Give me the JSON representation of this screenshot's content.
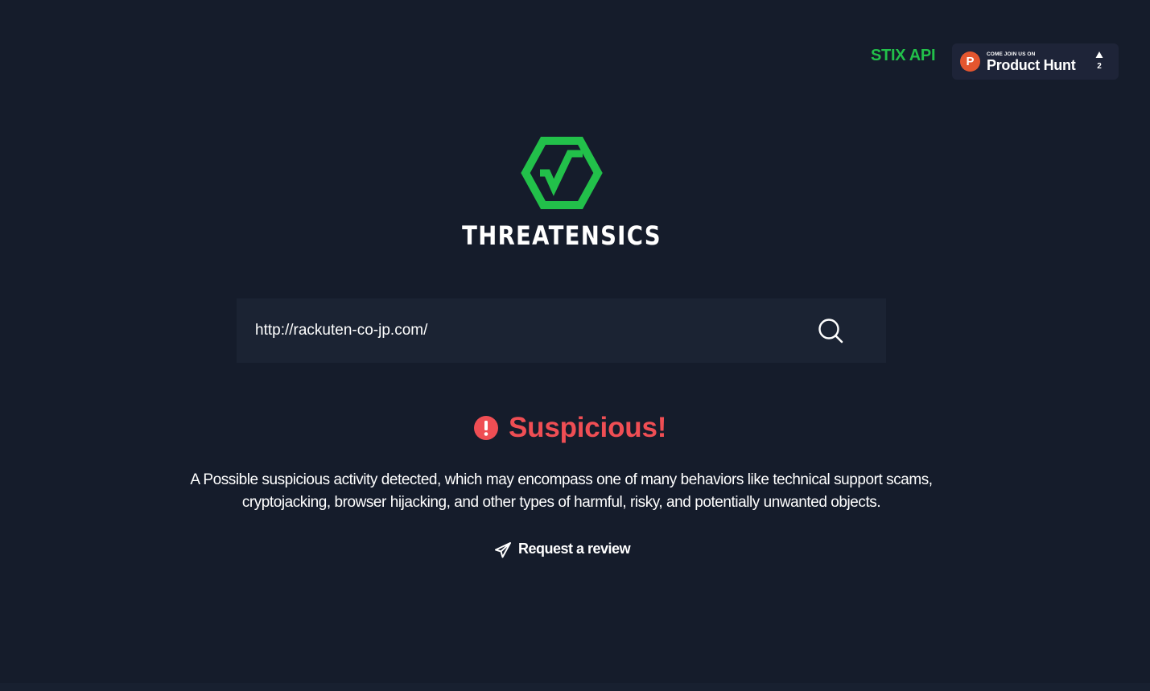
{
  "nav": {
    "stix_api_label": "STIX API",
    "product_hunt": {
      "eyebrow": "COME JOIN US ON",
      "name": "Product Hunt",
      "logo_letter": "P",
      "vote_count": "2"
    }
  },
  "brand": {
    "name": "THREATENSICS",
    "logo_icon": "hexagon-checkmark-icon",
    "accent_color": "#22c04a"
  },
  "search": {
    "value": "http://rackuten-co-jp.com/",
    "icon": "search-icon"
  },
  "result": {
    "icon": "exclamation-circle-icon",
    "verdict": "Suspicious!",
    "verdict_color": "#ef4e54",
    "description": "A Possible suspicious activity detected, which may encompass one of many behaviors like technical support scams, cryptojacking, browser hijacking, and other types of harmful, risky, and potentially unwanted objects.",
    "review_label": "Request a review",
    "review_icon": "paper-plane-icon"
  },
  "colors": {
    "background": "#151c2b",
    "search_background": "#1b2333",
    "product_hunt_orange": "#e4562f"
  }
}
